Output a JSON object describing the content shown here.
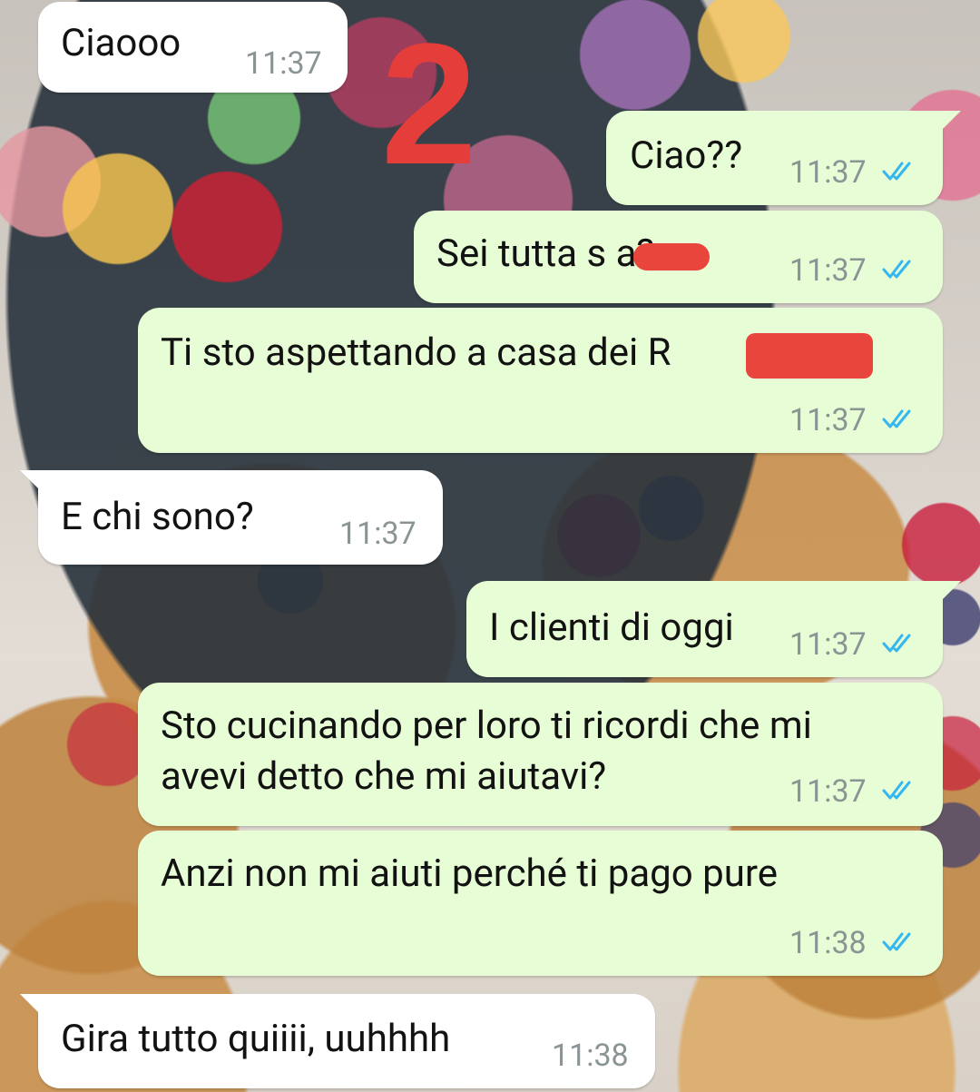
{
  "overlay_number": "2",
  "messages": [
    {
      "dir": "in",
      "text": "Ciaooo",
      "time": "11:37"
    },
    {
      "dir": "out",
      "text": "Ciao??",
      "time": "11:37",
      "status": "read"
    },
    {
      "dir": "out",
      "text": "Sei tutta s     a?",
      "time": "11:37",
      "status": "read"
    },
    {
      "dir": "out",
      "text": "Ti sto aspettando a casa dei R",
      "time": "11:37",
      "status": "read"
    },
    {
      "dir": "in",
      "text": "E chi sono?",
      "time": "11:37"
    },
    {
      "dir": "out",
      "text": "I clienti di oggi",
      "time": "11:37",
      "status": "read"
    },
    {
      "dir": "out",
      "line1": "Sto cucinando per loro ti ricordi che mi",
      "line2": "avevi detto che mi aiutavi?",
      "time": "11:37",
      "status": "read"
    },
    {
      "dir": "out",
      "text": "Anzi non mi aiuti perché ti pago pure",
      "time": "11:38",
      "status": "read"
    },
    {
      "dir": "in",
      "text": "Gira tutto quiiii, uuhhhh",
      "time": "11:38"
    }
  ],
  "colors": {
    "incoming": "#ffffff",
    "outgoing": "#e7fdd5",
    "read_ticks": "#34b7f1",
    "redaction": "#e8453c",
    "overlay_number": "#e43d3a"
  },
  "icons": {
    "read_receipt": "double-check-icon"
  }
}
